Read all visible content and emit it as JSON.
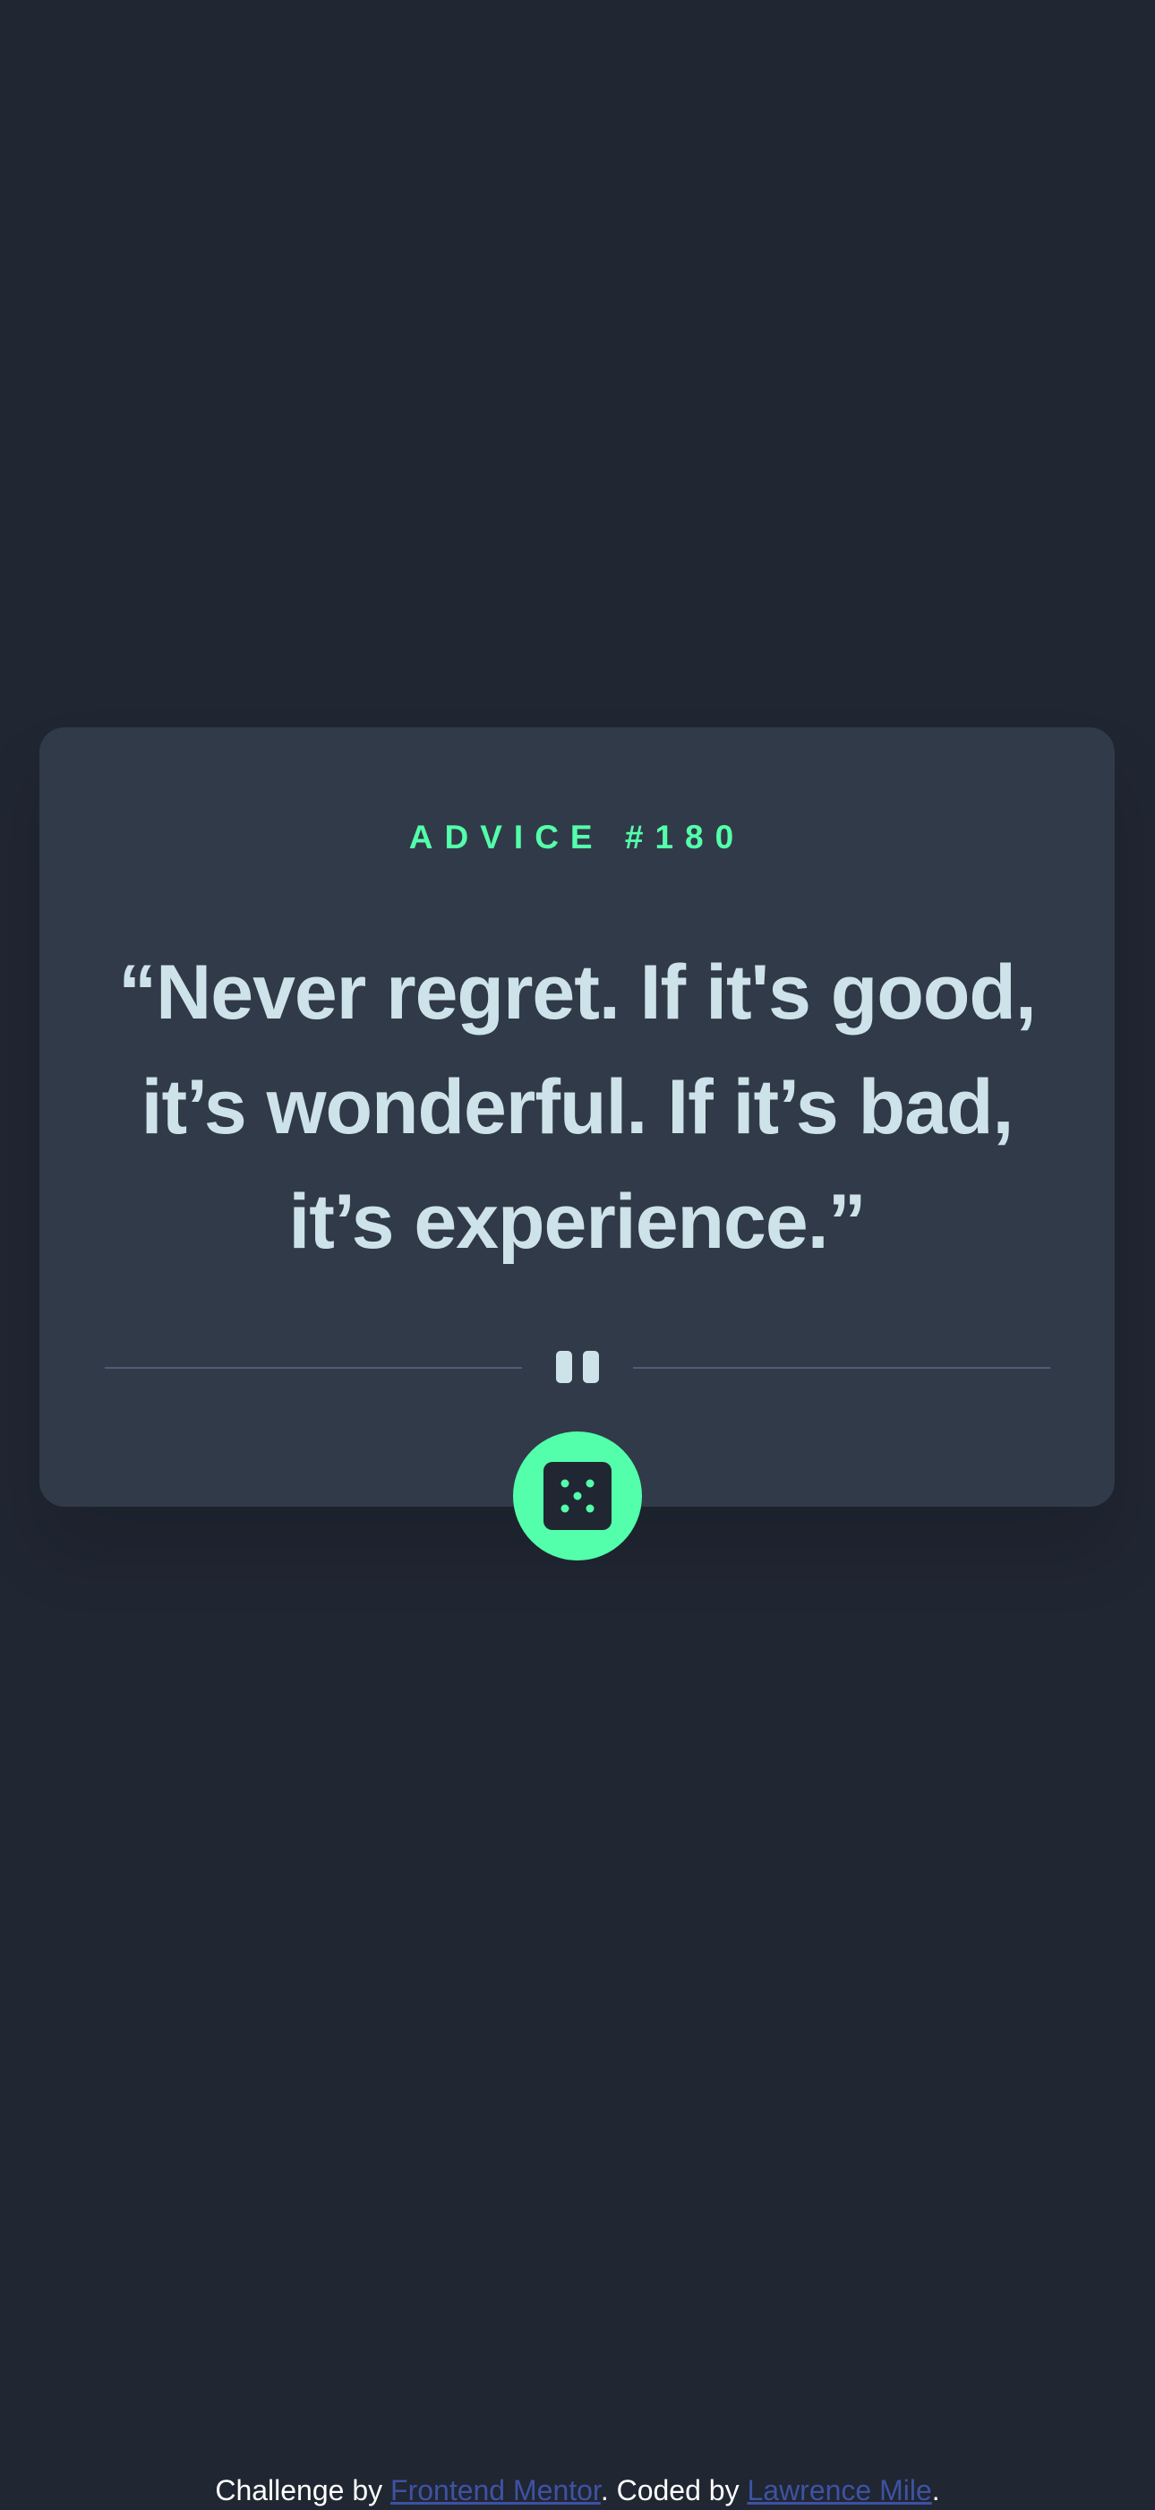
{
  "card": {
    "advice_id": "ADVICE #180",
    "advice_text": "“Never regret. If it's good, it’s wonderful. If it’s bad, it’s experience.”",
    "button_icon": "dice-icon"
  },
  "colors": {
    "background": "#202632",
    "card": "#313A48",
    "accent": "#53FFAA",
    "text": "#CEE3E9",
    "link": "#3E52A3"
  },
  "footer": {
    "prefix": "Challenge by ",
    "link1": "Frontend Mentor",
    "middle": ". Coded by ",
    "link2": "Lawrence Mile",
    "suffix": "."
  }
}
